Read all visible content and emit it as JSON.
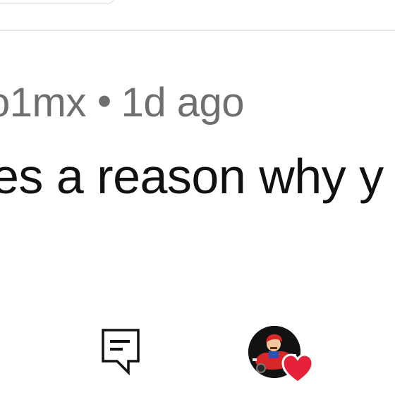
{
  "comment": {
    "username_fragment": "o1mx",
    "separator": "•",
    "timestamp": "1d ago",
    "text_fragment": "es a reason why y"
  },
  "actions": {
    "reply_icon": "reply-comment-icon",
    "reaction_avatar": "kart-racer-avatar",
    "reaction_icon": "heart-icon"
  },
  "colors": {
    "meta_text": "#6f6f6f",
    "body_text": "#111111",
    "divider": "#e4e4e4",
    "heart": "#e8213a"
  }
}
